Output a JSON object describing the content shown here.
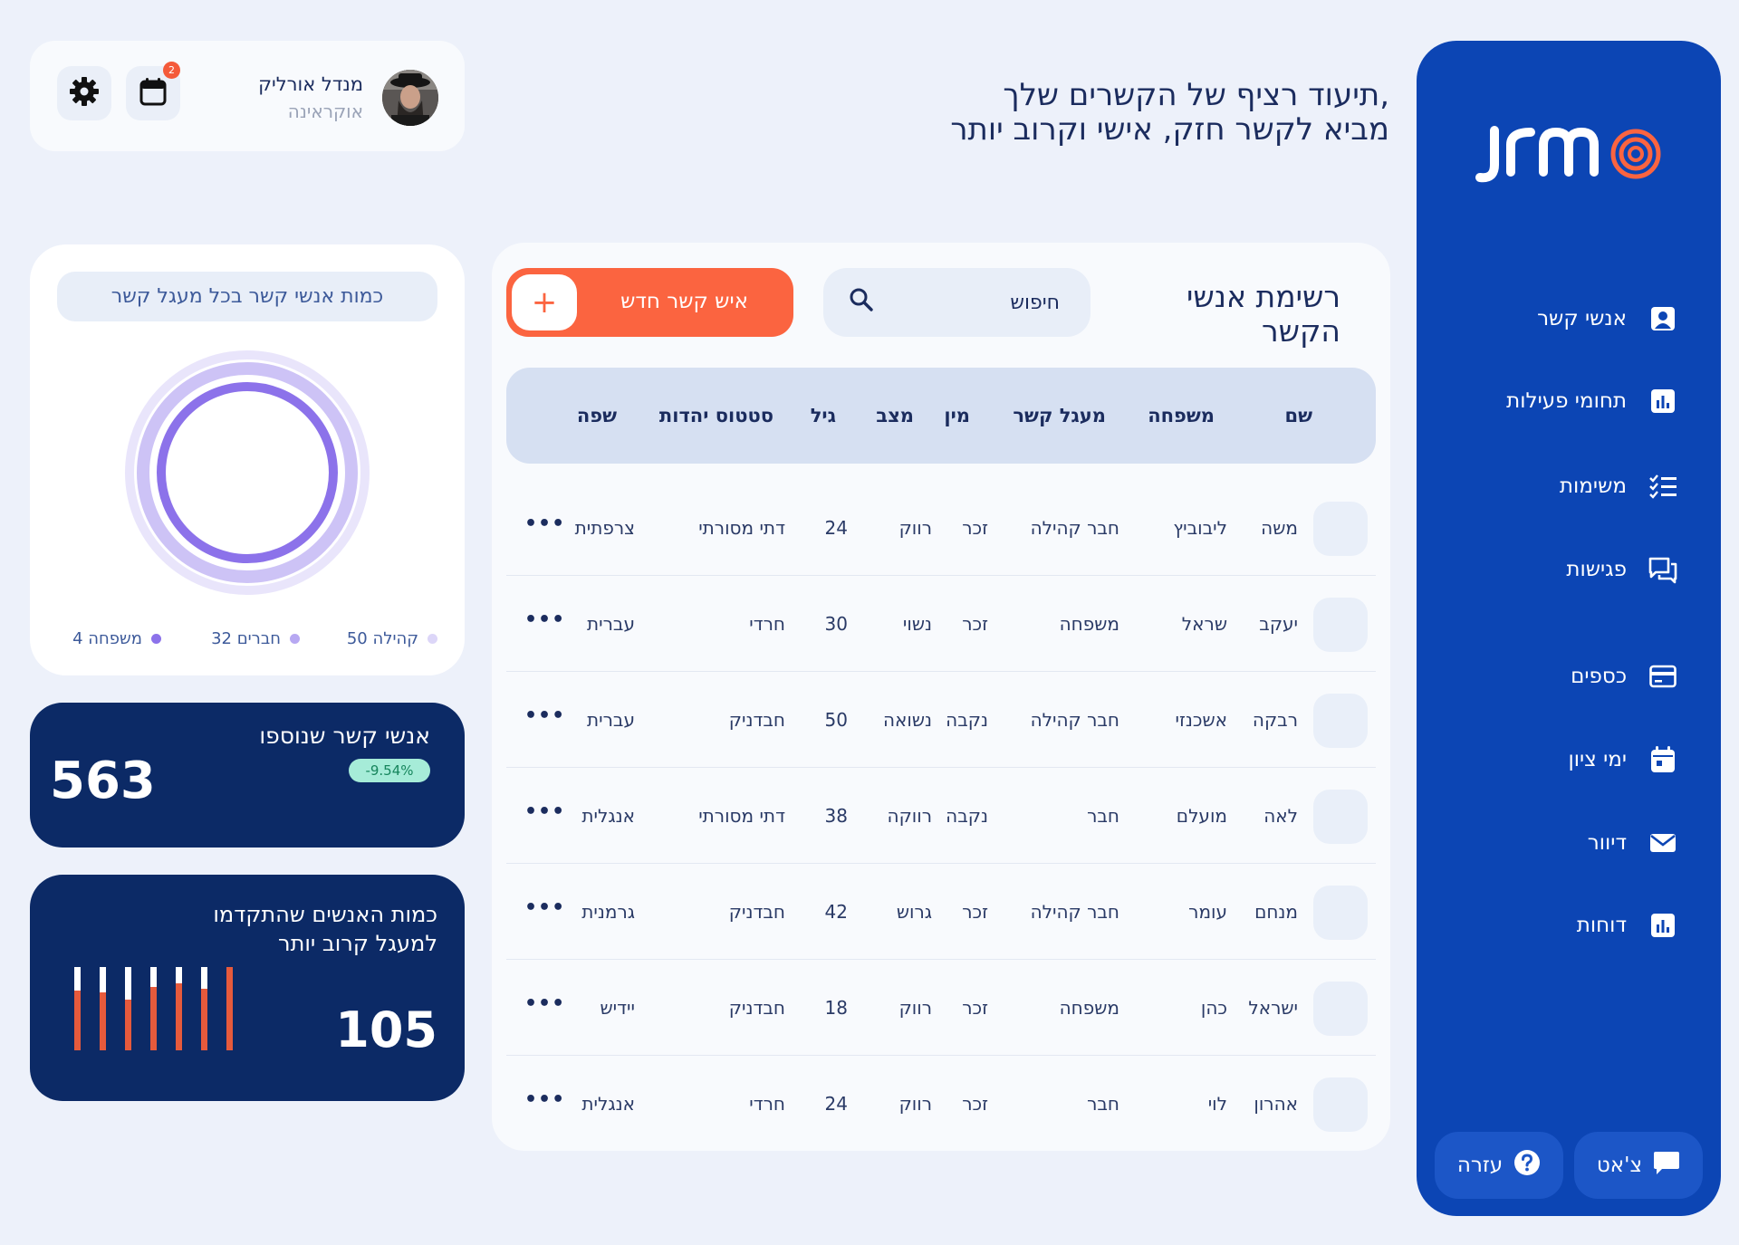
{
  "brand": {
    "logo_text": "jrm",
    "accent": "#fb6440",
    "primary": "#0c45b4",
    "dark": "#0c2a66"
  },
  "tagline": {
    "line1": "תיעוד רציף של הקשרים שלך,",
    "line2": "מביא לקשר חזק, אישי וקרוב יותר"
  },
  "profile": {
    "name": "מנדל אורליק",
    "country": "אוקראינה",
    "notifications": "2",
    "calendar_icon": "calendar-icon",
    "settings_icon": "gear-icon"
  },
  "sidebar": {
    "items": [
      {
        "label": "אנשי קשר",
        "icon": "contact-card-icon"
      },
      {
        "label": "תחומי פעילות",
        "icon": "bar-chart-icon"
      },
      {
        "label": "משימות",
        "icon": "checklist-icon"
      },
      {
        "label": "פגישות",
        "icon": "chat-bubbles-icon"
      },
      {
        "label": "כספים",
        "icon": "credit-card-icon"
      },
      {
        "label": "ימי ציון",
        "icon": "calendar-icon"
      },
      {
        "label": "דיוור",
        "icon": "envelope-icon"
      },
      {
        "label": "דוחות",
        "icon": "bar-chart-icon"
      }
    ],
    "chat_label": "צ'אט",
    "help_label": "עזרה"
  },
  "circles_card": {
    "title": "כמות אנשי קשר בכל מעגל קשר",
    "legend": [
      {
        "label": "50 קהילה",
        "color": "#dcd6f8"
      },
      {
        "label": "32 חברים",
        "color": "#b7a8f2"
      },
      {
        "label": "4 משפחה",
        "color": "#8c72ea"
      }
    ]
  },
  "added_card": {
    "title": "אנשי קשר שנוספו",
    "value": "563",
    "change": "-9.54%"
  },
  "advanced_card": {
    "title_line1": "כמות האנשים שהתקדמו",
    "title_line2": "למעגל קרוב יותר",
    "value": "105"
  },
  "contacts": {
    "title_line1": "רשימת אנשי",
    "title_line2": "הקשר",
    "search_placeholder": "חיפוש",
    "new_button": "איש קשר חדש",
    "new_button_icon": "+",
    "more": "•••",
    "columns": [
      "שם",
      "משפחה",
      "מעגל קשר",
      "מין",
      "מצב",
      "גיל",
      "סטטוס יהדות",
      "שפה"
    ],
    "rows": [
      [
        "משה",
        "ליבוביץ",
        "חבר קהילה",
        "זכר",
        "רווק",
        "24",
        "דתי מסורתי",
        "צרפתית"
      ],
      [
        "יעקב",
        "שראל",
        "משפחה",
        "זכר",
        "נשוי",
        "30",
        "חרדי",
        "עברית"
      ],
      [
        "רבקה",
        "אשכנזי",
        "חבר קהילה",
        "נקבה",
        "נשואה",
        "50",
        "חבדניק",
        "עברית"
      ],
      [
        "לאה",
        "מועלם",
        "חבר",
        "נקבה",
        "רווקה",
        "38",
        "דתי מסורתי",
        "אנגלית"
      ],
      [
        "מנחם",
        "עומר",
        "חבר קהילה",
        "זכר",
        "גרוש",
        "42",
        "חבדניק",
        "גרמנית"
      ],
      [
        "ישראל",
        "כהן",
        "משפחה",
        "זכר",
        "רווק",
        "18",
        "חבדניק",
        "יידיש"
      ],
      [
        "אהרון",
        "לוי",
        "חבר",
        "זכר",
        "רווק",
        "24",
        "חרדי",
        "אנגלית"
      ]
    ]
  }
}
